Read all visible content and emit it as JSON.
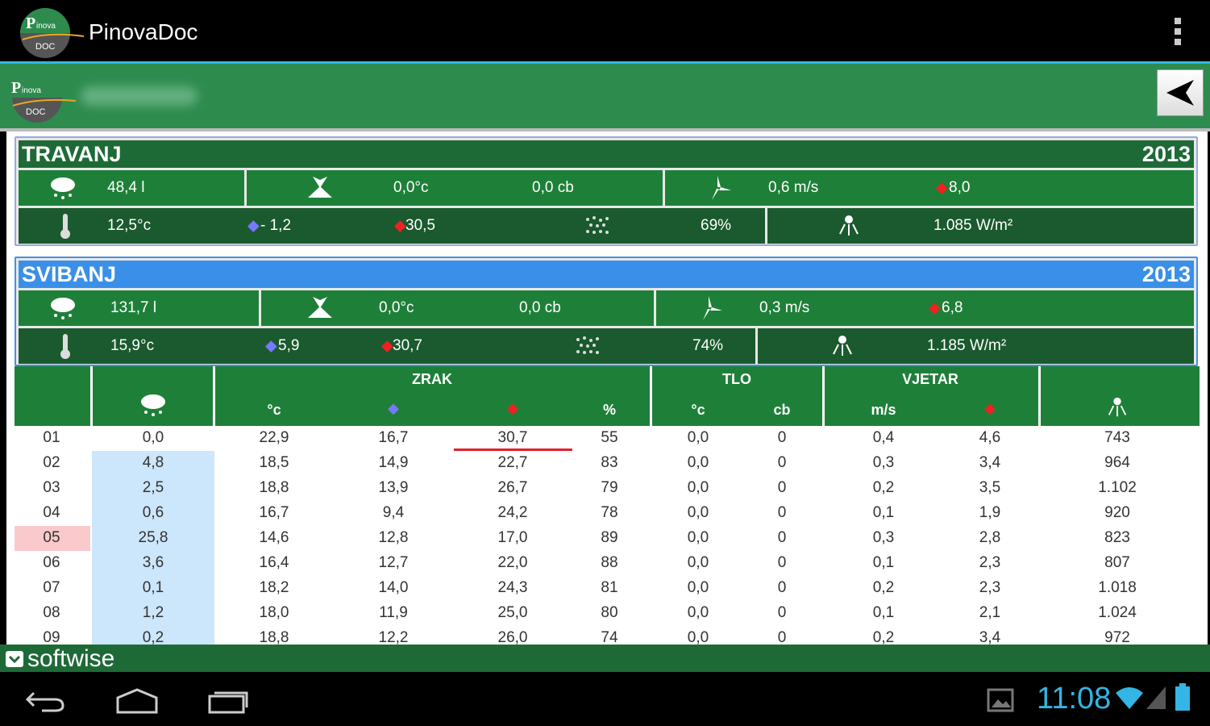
{
  "app": {
    "title": "PinovaDoc",
    "logo_text_top": "Pinova",
    "logo_text_bottom": "DOC"
  },
  "colors": {
    "green_dark": "#1d6a37",
    "green": "#1e8038",
    "blue": "#3a8fe8",
    "accent": "#33b5e5"
  },
  "months": [
    {
      "name": "TRAVANJ",
      "year": "2013",
      "rain": "48,4 l",
      "soil_temp": "0,0°c",
      "soil_cb": "0,0 cb",
      "wind": "0,6 m/s",
      "wind_max": "8,0",
      "air_temp": "12,5°c",
      "air_min": "- 1,2",
      "air_max": "30,5",
      "humidity": "69%",
      "radiation": "1.085 W/m²"
    },
    {
      "name": "SVIBANJ",
      "year": "2013",
      "rain": "131,7 l",
      "soil_temp": "0,0°c",
      "soil_cb": "0,0 cb",
      "wind": "0,3 m/s",
      "wind_max": "6,8",
      "air_temp": "15,9°c",
      "air_min": "5,9",
      "air_max": "30,7",
      "humidity": "74%",
      "radiation": "1.185 W/m²"
    }
  ],
  "table": {
    "groups": {
      "air": "ZRAK",
      "soil": "TLO",
      "wind": "VJETAR"
    },
    "subheaders": {
      "air_temp": "°c",
      "air_hum": "%",
      "soil_temp": "°c",
      "soil_cb": "cb",
      "wind_speed": "m/s"
    },
    "rows": [
      [
        "01",
        "0,0",
        "22,9",
        "16,7",
        "30,7",
        "55",
        "0,0",
        "0",
        "0,4",
        "4,6",
        "743"
      ],
      [
        "02",
        "4,8",
        "18,5",
        "14,9",
        "22,7",
        "83",
        "0,0",
        "0",
        "0,3",
        "3,4",
        "964"
      ],
      [
        "03",
        "2,5",
        "18,8",
        "13,9",
        "26,7",
        "79",
        "0,0",
        "0",
        "0,2",
        "3,5",
        "1.102"
      ],
      [
        "04",
        "0,6",
        "16,7",
        "9,4",
        "24,2",
        "78",
        "0,0",
        "0",
        "0,1",
        "1,9",
        "920"
      ],
      [
        "05",
        "25,8",
        "14,6",
        "12,8",
        "17,0",
        "89",
        "0,0",
        "0",
        "0,3",
        "2,8",
        "823"
      ],
      [
        "06",
        "3,6",
        "16,4",
        "12,7",
        "22,0",
        "88",
        "0,0",
        "0",
        "0,1",
        "2,3",
        "807"
      ],
      [
        "07",
        "0,1",
        "18,2",
        "14,0",
        "24,3",
        "81",
        "0,0",
        "0",
        "0,2",
        "2,3",
        "1.018"
      ],
      [
        "08",
        "1,2",
        "18,0",
        "11,9",
        "25,0",
        "80",
        "0,0",
        "0",
        "0,1",
        "2,1",
        "1.024"
      ],
      [
        "09",
        "0,2",
        "18,8",
        "12,2",
        "26,0",
        "74",
        "0,0",
        "0",
        "0,2",
        "3,4",
        "972"
      ]
    ],
    "highlight_row": "05"
  },
  "footer": {
    "brand": "softwise"
  },
  "status": {
    "time": "11:08"
  }
}
